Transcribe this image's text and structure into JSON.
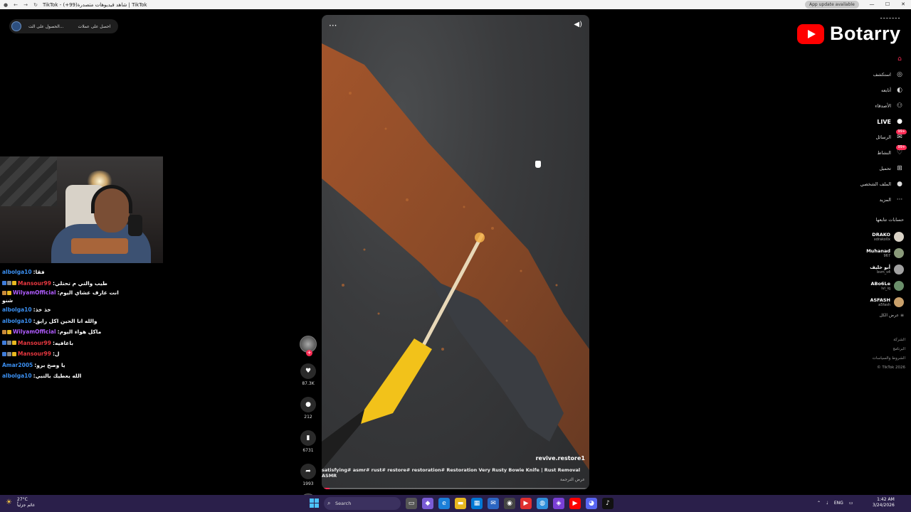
{
  "window": {
    "tab_title": "TikTok - شاهد فيديوهات متصدرة(99+) | TikTok",
    "update_badge": "App update available",
    "controls": [
      "—",
      "☐",
      "✕"
    ]
  },
  "top_pill": {
    "item1": "احصل على عملات",
    "item2": "الحصول على الت..."
  },
  "chat": [
    {
      "user": "albolga10",
      "color": "#3b8ff0",
      "message": "فقا",
      "badges": []
    },
    {
      "user": "Mansour99",
      "color": "#e5373f",
      "message": "طيب والتي م تحتلي",
      "badges": [
        "#3f7cd9",
        "#888888",
        "#e8b820"
      ]
    },
    {
      "user": "WilyamOfficial",
      "color": "#b05cff",
      "message": "انت عارف عشاي اليوم",
      "cont": "شنو",
      "badges": [
        "#c98a3a",
        "#e8b820"
      ]
    },
    {
      "user": "albolga10",
      "color": "#3b8ff0",
      "message": "خذ خذ",
      "badges": []
    },
    {
      "user": "albolga10",
      "color": "#3b8ff0",
      "message": "والله انا الحين اكل رايق",
      "badges": []
    },
    {
      "user": "WilyamOfficial",
      "color": "#b05cff",
      "message": "ماكل هواء اليوم",
      "badges": [
        "#c98a3a",
        "#e8b820"
      ]
    },
    {
      "user": "Mansour99",
      "color": "#e5373f",
      "message": "باعافيه",
      "badges": [
        "#3f7cd9",
        "#888888",
        "#e8b820"
      ]
    },
    {
      "user": "Mansour99",
      "color": "#e5373f",
      "message": "ل",
      "badges": [
        "#3f7cd9",
        "#888888",
        "#e8b820"
      ]
    },
    {
      "user": "Amar2005",
      "color": "#3b8ff0",
      "message": "يا وصخ برو",
      "badges": []
    },
    {
      "user": "albolga10",
      "color": "#3b8ff0",
      "message": "الله يعطيك بالتبي",
      "badges": []
    }
  ],
  "video": {
    "author": "revive.restore1",
    "caption": "satisfying# asmr# rust# restore# restoration# Restoration Very Rusty Bowie Knife | Rust Removal ASMR",
    "translate": "عرض الترجمة",
    "progress": 0.03
  },
  "actions": {
    "likes": "87.3K",
    "comments": "212",
    "saves": "6731",
    "shares": "1993"
  },
  "logo": {
    "name": "Botarry",
    "top_text": "ـ ـ ـ ـ ـ ـ ـ"
  },
  "sidenav": [
    {
      "label": "",
      "icon": "⌂",
      "name": "home"
    },
    {
      "label": "استكشف",
      "icon": "◎",
      "name": "explore"
    },
    {
      "label": "أتابعه",
      "icon": "◐",
      "name": "following"
    },
    {
      "label": "الأصدقاء",
      "icon": "⚇",
      "name": "friends"
    },
    {
      "label": "LIVE",
      "icon": "●",
      "name": "live"
    },
    {
      "label": "الرسائل",
      "icon": "✉",
      "name": "messages",
      "pill": "99+"
    },
    {
      "label": "النشاط",
      "icon": "♡",
      "name": "activity",
      "pill": "99+"
    },
    {
      "label": "تحميل",
      "icon": "⊞",
      "name": "upload"
    },
    {
      "label": "الملف الشخصي",
      "icon": "●",
      "name": "profile"
    },
    {
      "label": "المزيد",
      "icon": "···",
      "name": "more"
    }
  ],
  "following_header": "حسابات تتابعها",
  "following": [
    {
      "name": "DRAKO",
      "user": "xdrako0x",
      "color": "#d9d2c6"
    },
    {
      "name": "Muhanad",
      "user": "967",
      "color": "#8a9a7a"
    },
    {
      "name": "أبو خليف",
      "user": "bsm_s4",
      "color": "#a1a1a1"
    },
    {
      "name": "ABo6Le",
      "user": "lvl_iq",
      "color": "#6b8f6b"
    },
    {
      "name": "ASFASH",
      "user": "a5fash",
      "color": "#c9a06b"
    }
  ],
  "see_all": "عرض الكل",
  "footer_links": [
    "الشركة",
    "البرنامج",
    "الشروط والسياسات",
    "© TikTok 2026"
  ],
  "taskbar": {
    "temp": "27°C",
    "weather_text": "غائم جزئياً",
    "search": "Search",
    "lang": "ENG",
    "time": "1:42 AM",
    "date": "3/24/2026"
  }
}
